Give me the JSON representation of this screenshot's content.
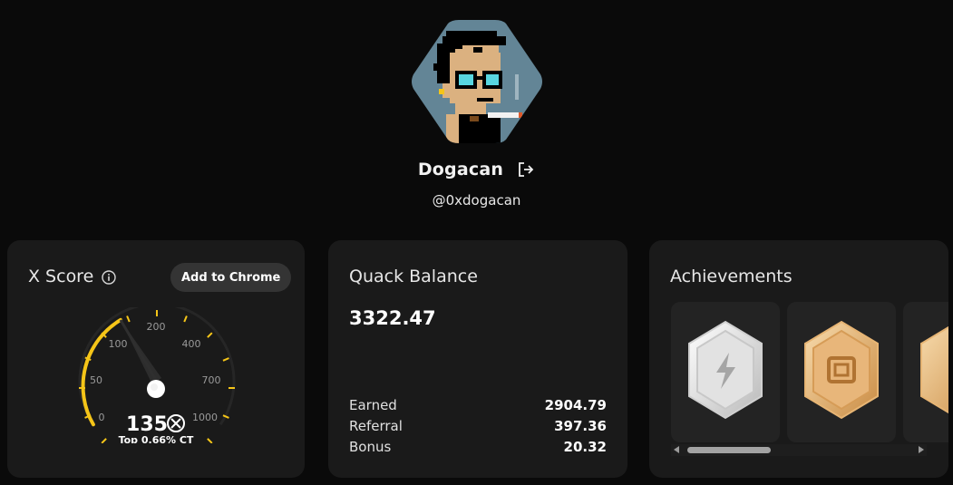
{
  "profile": {
    "name": "Dogacan",
    "handle": "@0xdogacan"
  },
  "x_score": {
    "title": "X Score",
    "button_label": "Add to Chrome",
    "value": "135",
    "rank_text": "Top 0.66% CT",
    "gauge_ticks": [
      "0",
      "50",
      "100",
      "200",
      "400",
      "700",
      "1000"
    ],
    "accent_color": "#f5c518"
  },
  "quack": {
    "title": "Quack Balance",
    "balance": "3322.47",
    "rows": [
      {
        "label": "Earned",
        "value": "2904.79"
      },
      {
        "label": "Referral",
        "value": "397.36"
      },
      {
        "label": "Bonus",
        "value": "20.32"
      }
    ]
  },
  "achievements": {
    "title": "Achievements",
    "badges": [
      "silver-lightning-badge-icon",
      "bronze-square-badge-icon",
      "bronze-badge-icon"
    ]
  }
}
